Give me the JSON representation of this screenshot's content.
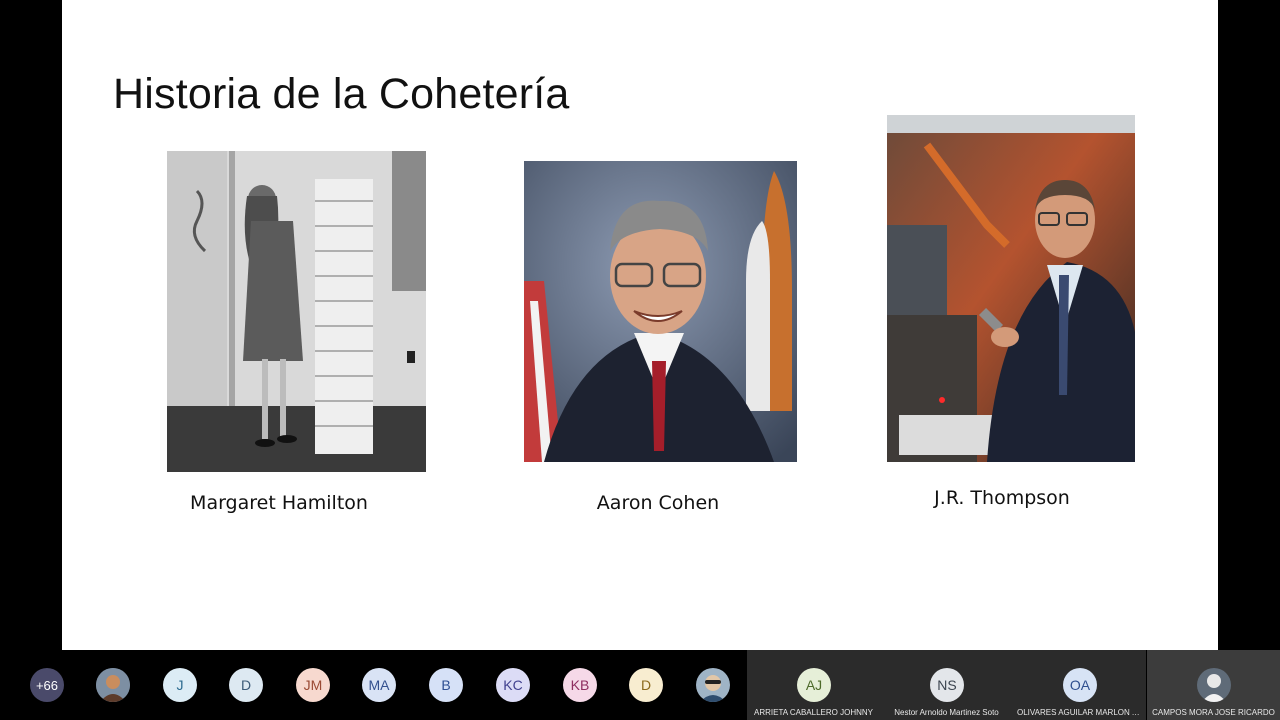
{
  "slide": {
    "title": "Historia de la Cohetería",
    "people": [
      {
        "caption": "Margaret Hamilton"
      },
      {
        "caption": "Aaron Cohen"
      },
      {
        "caption": "J.R. Thompson"
      }
    ]
  },
  "participants": {
    "overflow_count": "+66",
    "avatars": [
      {
        "initials": "J",
        "bg": "#dcecf5",
        "fg": "#2c6b8f"
      },
      {
        "initials": "D",
        "bg": "#dde9f2",
        "fg": "#3c5b78"
      },
      {
        "initials": "JM",
        "bg": "#f7d9cf",
        "fg": "#9a4a34"
      },
      {
        "initials": "MA",
        "bg": "#d9e3f5",
        "fg": "#34508e"
      },
      {
        "initials": "B",
        "bg": "#d6e1f7",
        "fg": "#2f4f93"
      },
      {
        "initials": "KC",
        "bg": "#dcdcf6",
        "fg": "#41418f"
      },
      {
        "initials": "KB",
        "bg": "#f6d9e8",
        "fg": "#8f2f60"
      },
      {
        "initials": "D",
        "bg": "#f8edd0",
        "fg": "#8c6a1e"
      }
    ],
    "tiles": [
      {
        "initials": "AJ",
        "name": "ARRIETA CABALLERO JOHNNY",
        "bg": "#e6efd8",
        "fg": "#4d6a2a"
      },
      {
        "initials": "NS",
        "name": "Nestor Arnoldo Martinez Soto",
        "bg": "#e3e6ea",
        "fg": "#3c4550"
      },
      {
        "initials": "OA",
        "name": "OLIVARES AGUILAR MARLON AND...",
        "bg": "#d7e3f5",
        "fg": "#2f4f8f"
      },
      {
        "initials": "",
        "name": "CAMPOS MORA JOSE RICARDO",
        "bg": "#3a3a3a",
        "fg": "#ffffff"
      }
    ]
  }
}
